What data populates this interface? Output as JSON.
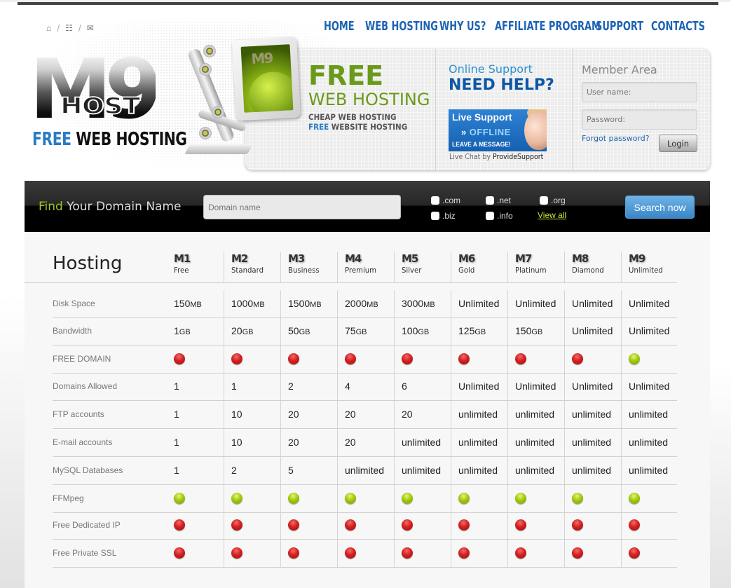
{
  "header": {
    "utility_icons": [
      "home-icon",
      "sitemap-icon",
      "mail-icon"
    ],
    "logo": {
      "mark": "M9",
      "sub": "HOST",
      "tag_highlight": "FREE",
      "tag_rest": " WEB HOSTING"
    },
    "nav": [
      "HOME",
      "WEB HOSTING",
      "WHY US?",
      "AFFILIATE PROGRAM",
      "SUPPORT",
      "CONTACTS"
    ],
    "monitor_label": "M9"
  },
  "promo": {
    "free": "FREE",
    "web_hosting": "WEB HOSTING",
    "line1": "CHEAP WEB HOSTING",
    "line2_highlight": "FREE",
    "line2_rest": " WEBSITE HOSTING"
  },
  "support": {
    "online": "Online Support",
    "need_help": "NEED HELP?",
    "live_title": "Live Support",
    "live_status": "OFFLINE",
    "live_action": "LEAVE A MESSAGE!",
    "credit_prefix": "Live Chat by ",
    "credit_brand": "ProvideSupport"
  },
  "member": {
    "title": "Member Area",
    "username_placeholder": "User name:",
    "password_placeholder": "Password:",
    "forgot": "Forgot password?",
    "login": "Login"
  },
  "domain": {
    "find_highlight": "Find",
    "find_rest": " Your Domain Name",
    "input_placeholder": "Domain name",
    "tlds": [
      {
        "label": ".com",
        "checked": false
      },
      {
        "label": ".net",
        "checked": false
      },
      {
        "label": ".org",
        "checked": false
      },
      {
        "label": ".biz",
        "checked": false
      },
      {
        "label": ".info",
        "checked": false
      }
    ],
    "view_all": "View all",
    "search": "Search now"
  },
  "table": {
    "title": "Hosting",
    "plans": [
      {
        "code": "M1",
        "name": "Free"
      },
      {
        "code": "M2",
        "name": "Standard"
      },
      {
        "code": "M3",
        "name": "Business"
      },
      {
        "code": "M4",
        "name": "Premium"
      },
      {
        "code": "M5",
        "name": "Silver"
      },
      {
        "code": "M6",
        "name": "Gold"
      },
      {
        "code": "M7",
        "name": "Platinum"
      },
      {
        "code": "M8",
        "name": "Diamond"
      },
      {
        "code": "M9",
        "name": "Unlimited"
      }
    ],
    "rows": [
      {
        "label": "Disk Space",
        "cells": [
          [
            "150",
            "MB"
          ],
          [
            "1000",
            "MB"
          ],
          [
            "1500",
            "MB"
          ],
          [
            "2000",
            "MB"
          ],
          [
            "3000",
            "MB"
          ],
          [
            "Unlimited",
            ""
          ],
          [
            "Unlimited",
            ""
          ],
          [
            "Unlimited",
            ""
          ],
          [
            "Unlimited",
            ""
          ]
        ]
      },
      {
        "label": "Bandwidth",
        "cells": [
          [
            "1",
            "GB"
          ],
          [
            "20",
            "GB"
          ],
          [
            "50",
            "GB"
          ],
          [
            "75",
            "GB"
          ],
          [
            "100",
            "GB"
          ],
          [
            "125",
            "GB"
          ],
          [
            "150",
            "GB"
          ],
          [
            "Unlimited",
            ""
          ],
          [
            "Unlimited",
            ""
          ]
        ]
      },
      {
        "label": "FREE DOMAIN",
        "cells": [
          "no",
          "no",
          "no",
          "no",
          "no",
          "no",
          "no",
          "no",
          "yes"
        ]
      },
      {
        "label": "Domains Allowed",
        "cells": [
          [
            "1",
            ""
          ],
          [
            "1",
            ""
          ],
          [
            "2",
            ""
          ],
          [
            "4",
            ""
          ],
          [
            "6",
            ""
          ],
          [
            "Unlimited",
            ""
          ],
          [
            "Unlimited",
            ""
          ],
          [
            "Unlimited",
            ""
          ],
          [
            "Unlimited",
            ""
          ]
        ]
      },
      {
        "label": "FTP accounts",
        "cells": [
          [
            "1",
            ""
          ],
          [
            "10",
            ""
          ],
          [
            "20",
            ""
          ],
          [
            "20",
            ""
          ],
          [
            "20",
            ""
          ],
          [
            "unlimited",
            ""
          ],
          [
            "unlimited",
            ""
          ],
          [
            "unlimited",
            ""
          ],
          [
            "unlimited",
            ""
          ]
        ]
      },
      {
        "label": "E-mail accounts",
        "cells": [
          [
            "1",
            ""
          ],
          [
            "10",
            ""
          ],
          [
            "20",
            ""
          ],
          [
            "20",
            ""
          ],
          [
            "unlimited",
            ""
          ],
          [
            "unlimited",
            ""
          ],
          [
            "unlimited",
            ""
          ],
          [
            "unlimited",
            ""
          ],
          [
            "unlimited",
            ""
          ]
        ]
      },
      {
        "label": "MySQL Databases",
        "cells": [
          [
            "1",
            ""
          ],
          [
            "2",
            ""
          ],
          [
            "5",
            ""
          ],
          [
            "unlimited",
            ""
          ],
          [
            "unlimited",
            ""
          ],
          [
            "unlimited",
            ""
          ],
          [
            "unlimited",
            ""
          ],
          [
            "unlimited",
            ""
          ],
          [
            "unlimited",
            ""
          ]
        ]
      },
      {
        "label": "FFMpeg",
        "cells": [
          "yes",
          "yes",
          "yes",
          "yes",
          "yes",
          "yes",
          "yes",
          "yes",
          "yes"
        ]
      },
      {
        "label": "Free Dedicated IP",
        "cells": [
          "no",
          "no",
          "no",
          "no",
          "no",
          "no",
          "no",
          "no",
          "no"
        ]
      },
      {
        "label": "Free Private SSL",
        "cells": [
          "no",
          "no",
          "no",
          "no",
          "no",
          "no",
          "no",
          "no",
          "no"
        ]
      }
    ]
  },
  "colors": {
    "nav_blue": "#1e64b4",
    "promo_green": "#6a9a1a",
    "accent_lime": "#9cc51d",
    "search_blue": "#3a86c9",
    "feature_yes": "#a2c90e",
    "feature_no": "#d32020"
  }
}
